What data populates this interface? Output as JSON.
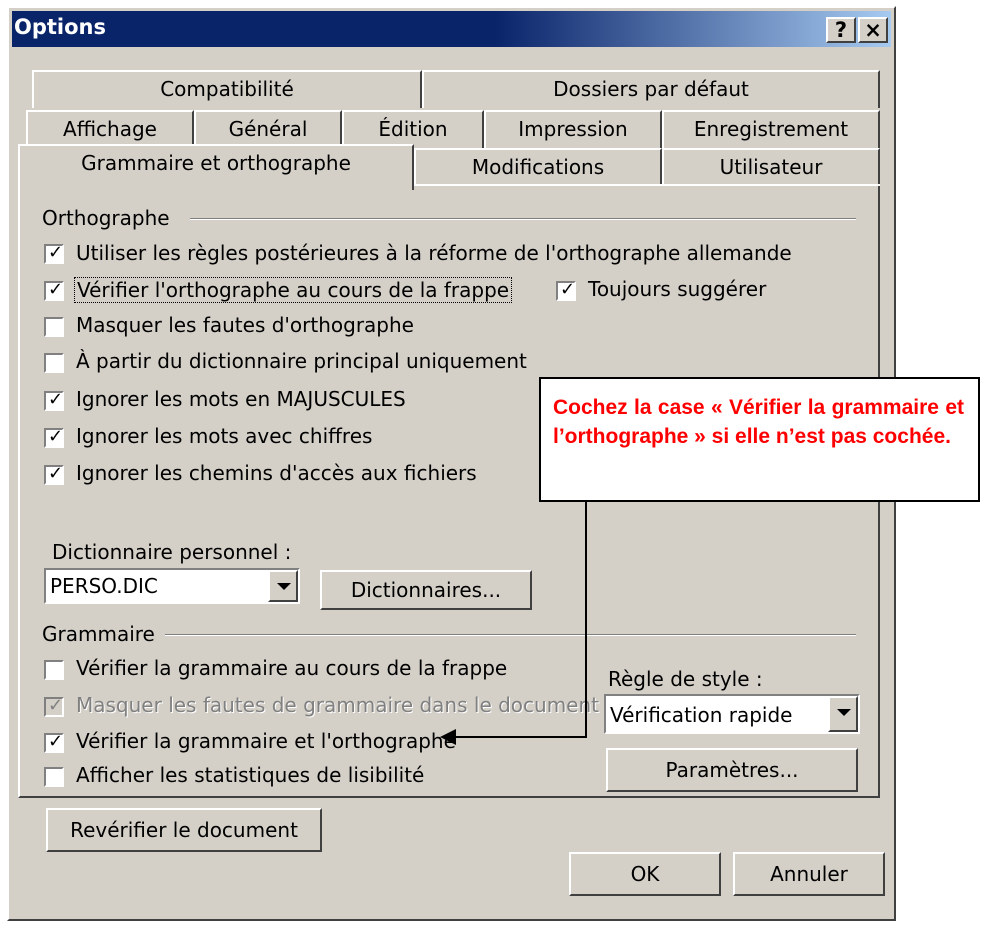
{
  "window": {
    "title": "Options",
    "help_label": "?",
    "close_label": "×"
  },
  "tabs_row1": [
    {
      "label": "Compatibilité"
    },
    {
      "label": "Dossiers par défaut"
    }
  ],
  "tabs_row2": [
    {
      "label": "Affichage"
    },
    {
      "label": "Général"
    },
    {
      "label": "Édition"
    },
    {
      "label": "Impression"
    },
    {
      "label": "Enregistrement"
    }
  ],
  "tabs_row3": [
    {
      "label": "Grammaire et orthographe",
      "selected": true
    },
    {
      "label": "Modifications"
    },
    {
      "label": "Utilisateur"
    }
  ],
  "orthographe": {
    "group_label": "Orthographe",
    "options": [
      {
        "label": "Utiliser les règles postérieures à la réforme de l'orthographe allemande",
        "checked": true
      },
      {
        "label": "Vérifier l'orthographe au cours de la frappe",
        "checked": true
      },
      {
        "label": "Masquer les fautes d'orthographe",
        "checked": false
      },
      {
        "label": "À partir du dictionnaire principal uniquement",
        "checked": false
      },
      {
        "label": "Ignorer les mots en MAJUSCULES",
        "checked": true
      },
      {
        "label": "Ignorer les mots avec chiffres",
        "checked": true
      },
      {
        "label": "Ignorer les chemins d'accès aux fichiers",
        "checked": true
      }
    ],
    "toujours": {
      "label": "Toujours suggérer",
      "checked": true
    },
    "dictionary_label": "Dictionnaire personnel :",
    "dictionary_value": "PERSO.DIC",
    "dictionaries_button": "Dictionnaires..."
  },
  "grammaire": {
    "group_label": "Grammaire",
    "options": [
      {
        "label": "Vérifier la grammaire au cours de la frappe",
        "checked": false,
        "disabled": false
      },
      {
        "label": "Masquer les fautes de grammaire dans le document",
        "checked": true,
        "disabled": true
      },
      {
        "label": "Vérifier la grammaire et l'orthographe",
        "checked": true,
        "disabled": false
      },
      {
        "label": "Afficher les statistiques de lisibilité",
        "checked": false,
        "disabled": false
      }
    ],
    "style_label": "Règle de style :",
    "style_value": "Vérification rapide",
    "parametres_button": "Paramètres...",
    "reverifier_button": "Revérifier le document"
  },
  "footer": {
    "ok_label": "OK",
    "cancel_label": "Annuler"
  },
  "callout": {
    "text": "Cochez la case « Vérifier la grammaire et l’orthographe » si elle n’est pas cochée."
  }
}
